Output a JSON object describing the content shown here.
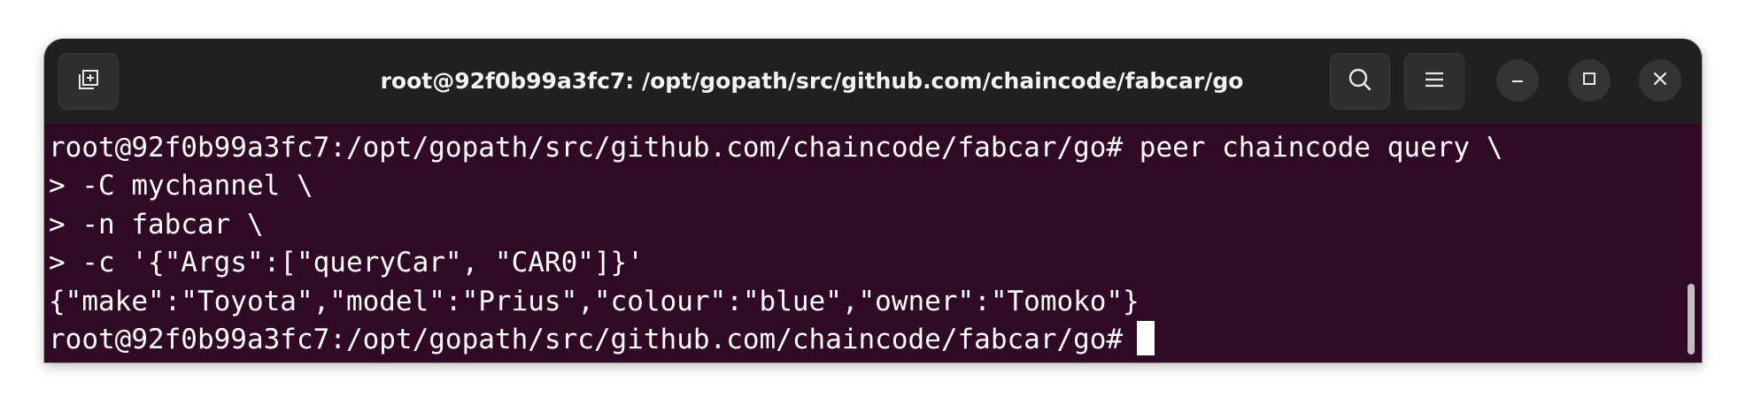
{
  "window": {
    "title": "root@92f0b99a3fc7: /opt/gopath/src/github.com/chaincode/fabcar/go",
    "buttons": {
      "new_tab": "new-tab-icon",
      "search": "search-icon",
      "menu": "hamburger-menu-icon",
      "minimize": "minimize-icon",
      "maximize": "maximize-icon",
      "close": "close-icon"
    }
  },
  "terminal": {
    "lines": [
      "root@92f0b99a3fc7:/opt/gopath/src/github.com/chaincode/fabcar/go# peer chaincode query \\",
      "> -C mychannel \\",
      "> -n fabcar \\",
      "> -c '{\"Args\":[\"queryCar\", \"CAR0\"]}'",
      "{\"make\":\"Toyota\",\"model\":\"Prius\",\"colour\":\"blue\",\"owner\":\"Tomoko\"}",
      "root@92f0b99a3fc7:/opt/gopath/src/github.com/chaincode/fabcar/go#"
    ]
  },
  "colors": {
    "titlebar_bg": "#202020",
    "terminal_bg": "#300a24",
    "terminal_fg": "#ffffff"
  }
}
